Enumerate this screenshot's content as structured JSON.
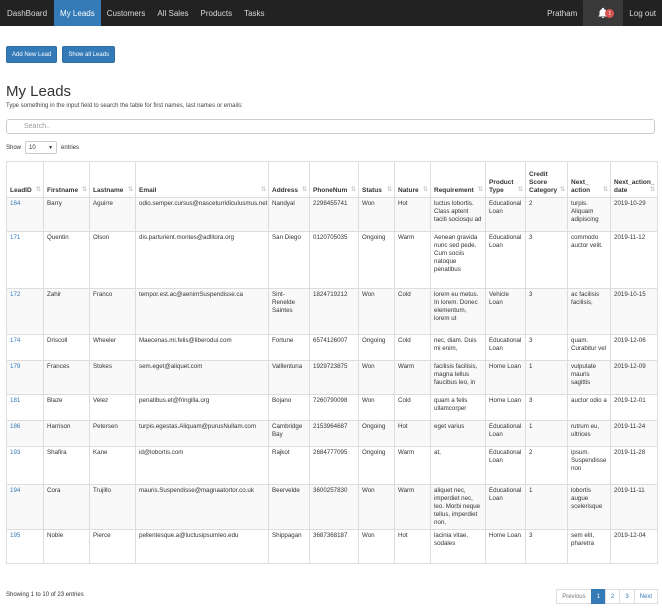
{
  "nav": {
    "brand": "DashBoard",
    "items": [
      "My Leads",
      "Customers",
      "All Sales",
      "Products",
      "Tasks"
    ],
    "user": "Pratham",
    "notification_count": "1",
    "logout": "Log out"
  },
  "buttons": {
    "add_new_lead": "Add New Lead",
    "show_all_leads": "Show all Leads"
  },
  "page_title": "My Leads",
  "hint": "Type something in the input field to search the table for first names, last names or emails:",
  "search": {
    "placeholder": "Search.."
  },
  "length": {
    "show": "Show",
    "value": "10",
    "entries": "entries"
  },
  "table": {
    "headers": [
      "LeadID",
      "Firstname",
      "Lastname",
      "Email",
      "Address",
      "PhoneNum",
      "Status",
      "Nature",
      "Requirement",
      "Product Type",
      "Credit Score Category",
      "Next_ action",
      "Next_action_ date"
    ],
    "rows": [
      [
        "164",
        "Barry",
        "Aguirre",
        "odio.semper.cursus@nasceturridiculusmus.net",
        "Nandyal",
        "2298455741",
        "Won",
        "Hot",
        "luctus lobortis. Class aptent taciti sociosqu ad",
        "Educational Loan",
        "2",
        "turpis. Aliquam adipiscing",
        "2019-10-29"
      ],
      [
        "171",
        "Quentin",
        "Olson",
        "dis.parturient.montes@adlitora.org",
        "San Diego",
        "0120705035",
        "Ongoing",
        "Warm",
        "Aenean gravida nunc sed pede. Cum sociis natoque penatibus",
        "Educational Loan",
        "3",
        "commodo auctor velit.",
        "2019-11-12"
      ],
      [
        "172",
        "Zahir",
        "Franco",
        "tempor.est.ac@aenimSuspendisse.ca",
        "Sint-Renelde Saintes",
        "1824719212",
        "Won",
        "Cold",
        "lorem eu metus. In lorem. Donec elementum, lorem ut",
        "Vehicle Loan",
        "3",
        "ac facilisis facilisis,",
        "2019-10-15"
      ],
      [
        "174",
        "Driscoll",
        "Wheeler",
        "Maecenas.mi.felis@liberodui.com",
        "Fortune",
        "6574126007",
        "Ongoing",
        "Cold",
        "nec, diam. Duis mi enim,",
        "Educational Loan",
        "3",
        "quam. Curabitur vel",
        "2019-12-06"
      ],
      [
        "179",
        "Frances",
        "Stokes",
        "sem.eget@aliquet.com",
        "Valllentuna",
        "1929723875",
        "Won",
        "Warm",
        "facilisis facilisis, magna tellus faucibus leo, in",
        "Home Loan",
        "1",
        "vulputate mauris sagittis",
        "2019-12-09"
      ],
      [
        "181",
        "Blaze",
        "Velez",
        "penatibus.et@fringilla.org",
        "Bojano",
        "7260790098",
        "Won",
        "Cold",
        "quam a felis ullamcorper",
        "Home Loan",
        "3",
        "auctor odio a",
        "2019-12-01"
      ],
      [
        "186",
        "Harrison",
        "Petersen",
        "turpis.egestas.Aliquam@purusNullam.com",
        "Cambridge Bay",
        "2153964687",
        "Ongoing",
        "Hot",
        "eget varius",
        "Educational Loan",
        "1",
        "rutrum eu, ultrices",
        "2019-11-24"
      ],
      [
        "193",
        "Shafira",
        "Kane",
        "id@lobortis.com",
        "Rajkot",
        "2684777095",
        "Ongoing",
        "Warm",
        "at,",
        "Educational Loan",
        "2",
        "ipsum. Suspendisse non",
        "2019-11-28"
      ],
      [
        "194",
        "Cora",
        "Trujillo",
        "mauris.Suspendisse@magnaatortor.co.uk",
        "Beervelde",
        "3600257830",
        "Won",
        "Warm",
        "aliquet nec, imperdiet nec, leo. Morbi neque tellus, imperdiet non,",
        "Educational Loan",
        "1",
        "lobortis augue scelerisque",
        "2019-11-11"
      ],
      [
        "195",
        "Noble",
        "Pierce",
        "pellentesque.a@luctusipsumleo.edu",
        "Shippagan",
        "3687368187",
        "Won",
        "Hot",
        "lacinia vitae, sodales",
        "Home Loan",
        "3",
        "sem elit, pharetra",
        "2019-12-04"
      ]
    ]
  },
  "info": "Showing 1 to 10 of 23 entries",
  "pagination": {
    "previous": "Previous",
    "pages": [
      "1",
      "2",
      "3"
    ],
    "next": "Next"
  },
  "colors": {
    "primary": "#337ab7",
    "navbar": "#222222",
    "badge": "#d9534f"
  }
}
